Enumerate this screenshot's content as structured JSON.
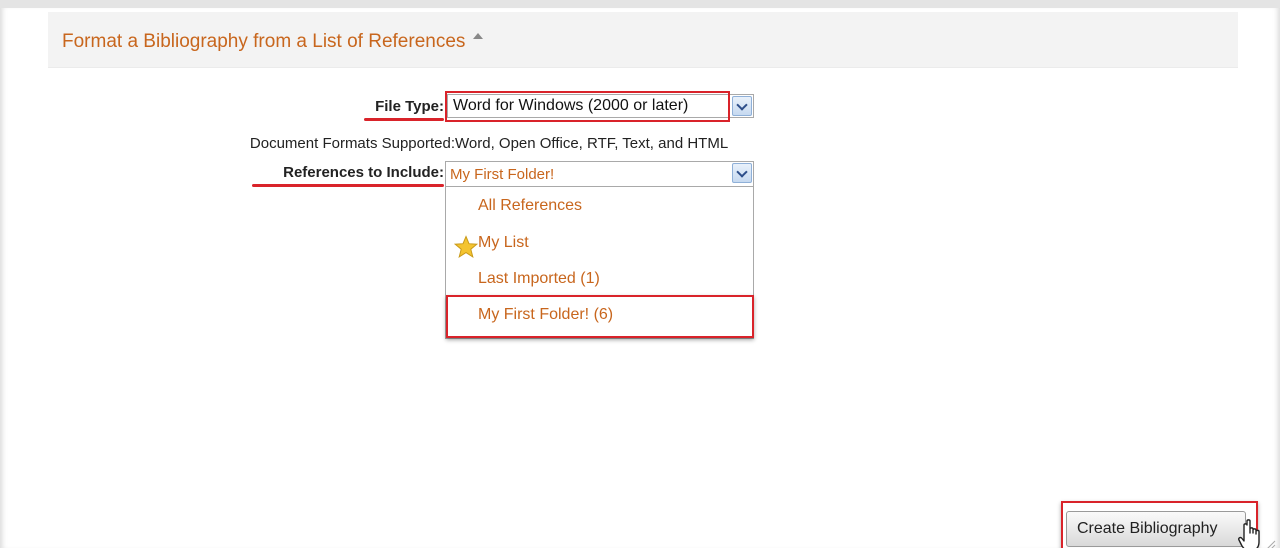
{
  "section": {
    "title": "Format a Bibliography from a List of References"
  },
  "form": {
    "file_type_label": "File Type:",
    "file_type_value": "Word for Windows (2000 or later)",
    "formats_label": "Document Formats Supported:",
    "formats_value": "Word, Open Office, RTF, Text, and HTML",
    "references_label": "References to Include:",
    "references_value": "My First Folder!",
    "references_options": [
      "All References",
      "My List",
      "Last Imported (1)",
      "My First Folder! (6)"
    ]
  },
  "actions": {
    "create_label": "Create Bibliography"
  },
  "colors": {
    "accent_orange": "#c8661d",
    "highlight_red": "#d9232a",
    "header_bg": "#f3f3f3"
  },
  "icons": {
    "collapse": "collapse-up-icon",
    "dropdown": "chevron-down-icon",
    "favorite": "star-icon",
    "cursor": "hand-cursor-icon"
  }
}
